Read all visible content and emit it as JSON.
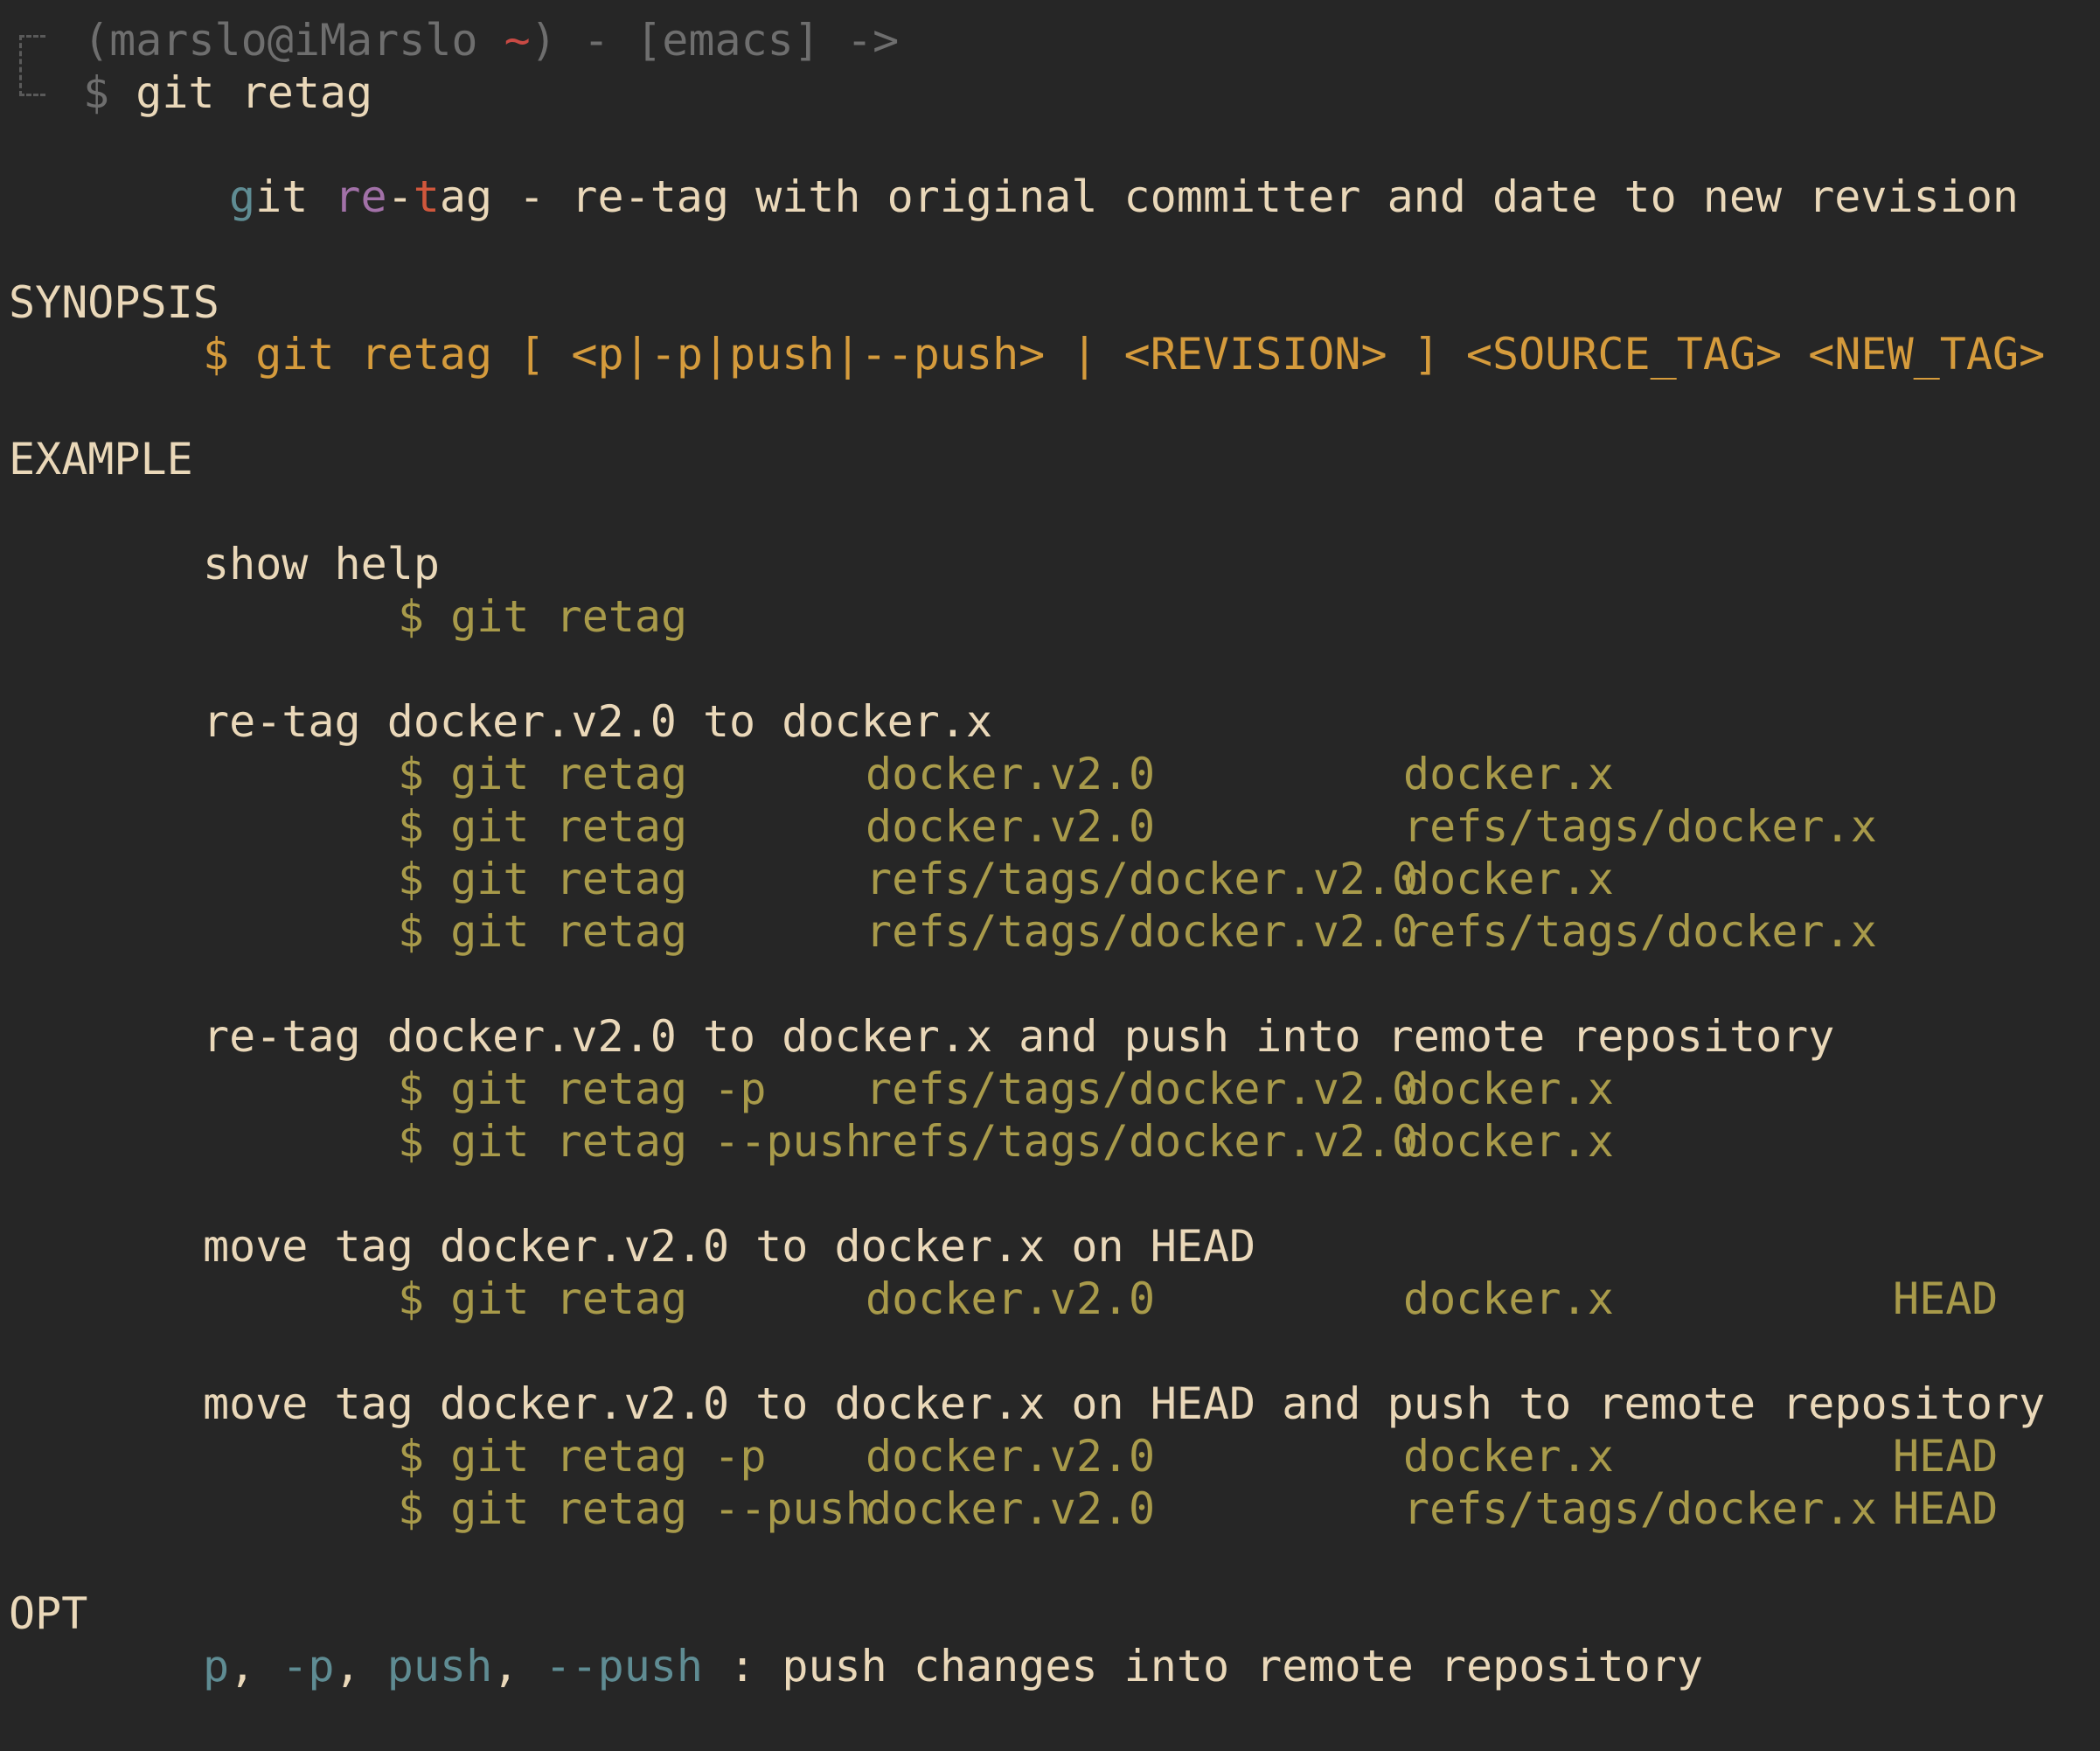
{
  "prompt": {
    "user_host": "(marslo@iMarslo ",
    "cwd": "~",
    "close": ") - ",
    "mode": "[emacs]",
    "arrow": " ->",
    "dollar": "$ ",
    "command": "git retag"
  },
  "title": {
    "g": "g",
    "it": "it ",
    "re": "re",
    "dash": "-",
    "t": "t",
    "ag": "ag",
    "desc": " - re-tag with original committer and date to new revision"
  },
  "synopsis": {
    "heading": "SYNOPSIS",
    "usage": "$ git retag [ <p|-p|push|--push> | <REVISION> ] <SOURCE_TAG> <NEW_TAG>"
  },
  "example": {
    "heading": "EXAMPLE",
    "groups": [
      {
        "desc": "show help",
        "rows": [
          {
            "cmd": "$ git retag",
            "src": "",
            "dst": "",
            "rev": ""
          }
        ]
      },
      {
        "desc": "re-tag docker.v2.0 to docker.x",
        "rows": [
          {
            "cmd": "$ git retag",
            "src": "docker.v2.0",
            "dst": "docker.x",
            "rev": ""
          },
          {
            "cmd": "$ git retag",
            "src": "docker.v2.0",
            "dst": "refs/tags/docker.x",
            "rev": ""
          },
          {
            "cmd": "$ git retag",
            "src": "refs/tags/docker.v2.0",
            "dst": "docker.x",
            "rev": ""
          },
          {
            "cmd": "$ git retag",
            "src": "refs/tags/docker.v2.0",
            "dst": "refs/tags/docker.x",
            "rev": ""
          }
        ]
      },
      {
        "desc": "re-tag docker.v2.0 to docker.x and push into remote repository",
        "rows": [
          {
            "cmd": "$ git retag -p",
            "src": "refs/tags/docker.v2.0",
            "dst": "docker.x",
            "rev": ""
          },
          {
            "cmd": "$ git retag --push",
            "src": "refs/tags/docker.v2.0",
            "dst": "docker.x",
            "rev": ""
          }
        ]
      },
      {
        "desc": "move tag docker.v2.0 to docker.x on HEAD",
        "rows": [
          {
            "cmd": "$ git retag",
            "src": "docker.v2.0",
            "dst": "docker.x",
            "rev": "HEAD"
          }
        ]
      },
      {
        "desc": "move tag docker.v2.0 to docker.x on HEAD and push to remote repository",
        "rows": [
          {
            "cmd": "$ git retag -p",
            "src": "docker.v2.0",
            "dst": "docker.x",
            "rev": "HEAD"
          },
          {
            "cmd": "$ git retag --push",
            "src": "docker.v2.0",
            "dst": "refs/tags/docker.x",
            "rev": "HEAD"
          }
        ]
      }
    ]
  },
  "opt": {
    "heading": "OPT",
    "o1": "p",
    "sep1": ", ",
    "o2": "-p",
    "sep2": ", ",
    "o3": "push",
    "sep3": ", ",
    "o4": "--push",
    "desc": " : push changes into remote repository"
  },
  "colors": {
    "background": "#262626",
    "text": "#ead8b9",
    "command": "#a89a4a",
    "synopsis": "#d59b3c",
    "option": "#5f8c93",
    "dim": "#6e6e6e",
    "accent_red": "#c94a44"
  }
}
